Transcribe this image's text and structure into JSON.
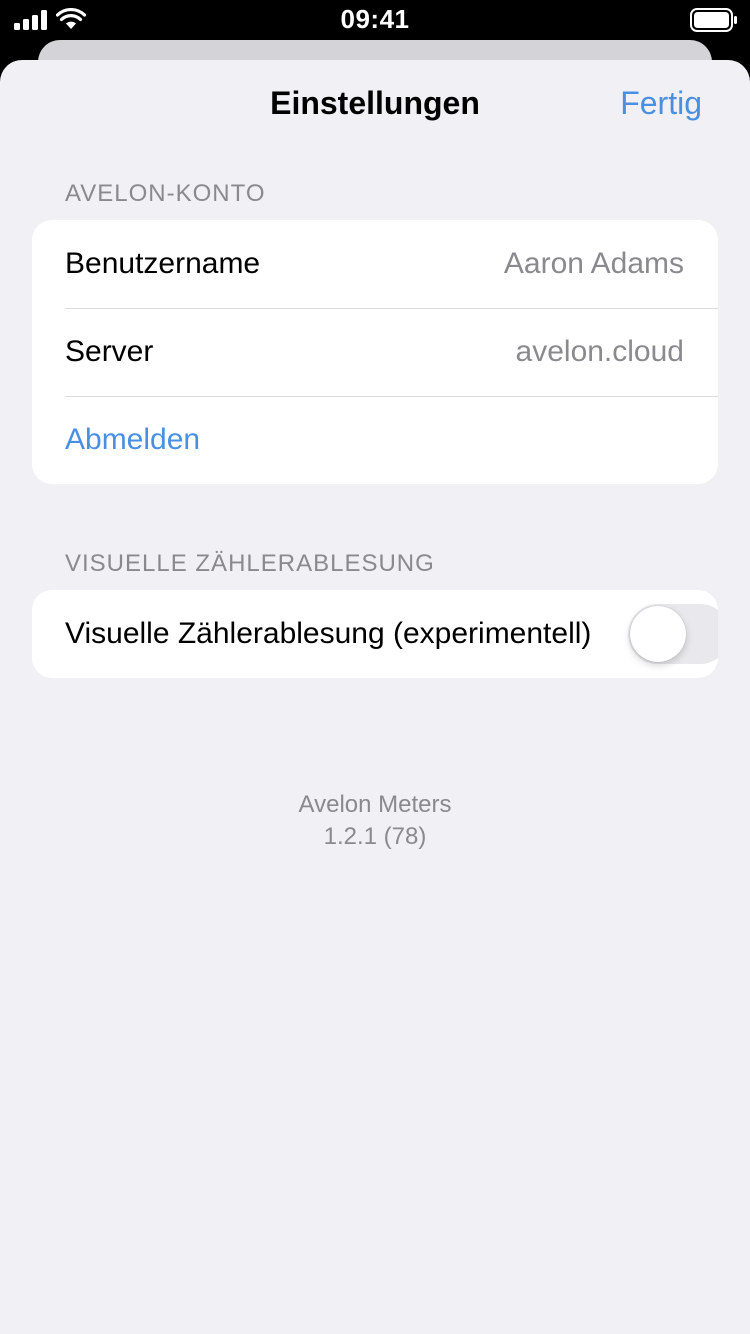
{
  "status_bar": {
    "time": "09:41",
    "icons": [
      "signal-icon",
      "wifi-icon",
      "battery-icon"
    ]
  },
  "nav": {
    "title": "Einstellungen",
    "done_label": "Fertig"
  },
  "account_section": {
    "header": "AVELON-KONTO",
    "rows": [
      {
        "label": "Benutzername",
        "value": "Aaron Adams"
      },
      {
        "label": "Server",
        "value": "avelon.cloud"
      }
    ],
    "logout_label": "Abmelden"
  },
  "visual_section": {
    "header": "VISUELLE ZÄHLERABLESUNG",
    "toggle_label": "Visuelle Zählerablesung (experimentell)",
    "toggle_on": false
  },
  "footer": {
    "app_name": "Avelon Meters",
    "version": "1.2.1 (78)"
  },
  "colors": {
    "accent": "#4a90e2",
    "background": "#f0f0f5",
    "secondary_text": "#8a8a8e"
  }
}
